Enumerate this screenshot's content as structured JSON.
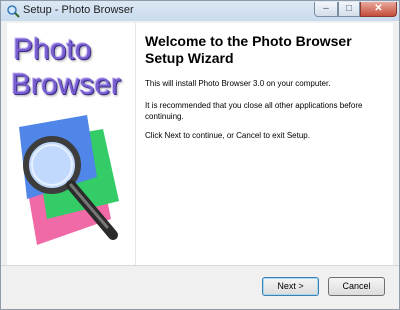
{
  "window": {
    "title": "Setup - Photo Browser",
    "controls": {
      "minimize": "–",
      "maximize": "□",
      "close": "✕"
    }
  },
  "sidebar": {
    "brand_line1": "Photo",
    "brand_line2": "Browser",
    "image": "magnifier-over-photos"
  },
  "main": {
    "heading": "Welcome to the Photo Browser Setup Wizard",
    "paragraphs": [
      "This will install Photo Browser 3.0 on your computer.",
      "It is recommended that you close all other applications before continuing.",
      "Click Next to continue, or Cancel to exit Setup."
    ]
  },
  "buttons": {
    "next": "Next >",
    "cancel": "Cancel"
  },
  "colors": {
    "brand": "#7a5fd1",
    "photo_blue": "#4f86e8",
    "photo_green": "#33cc66",
    "photo_pink": "#f06aa8"
  }
}
